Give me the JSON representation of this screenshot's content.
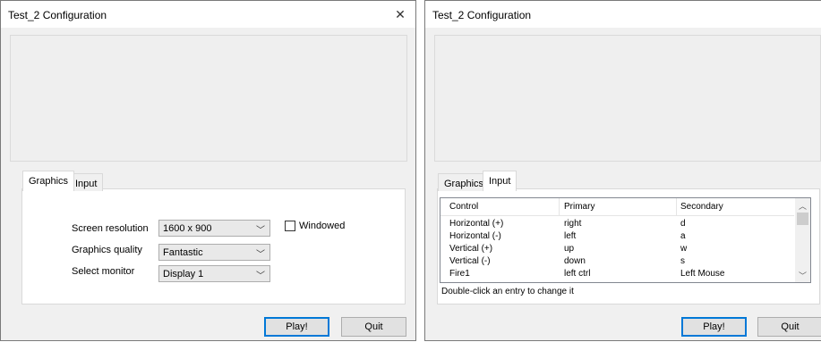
{
  "window_left": {
    "title": "Test_2 Configuration",
    "close_glyph": "✕",
    "tabs": [
      {
        "label": "Graphics"
      },
      {
        "label": "Input"
      }
    ],
    "active_tab": "Graphics",
    "settings": {
      "resolution_label": "Screen resolution",
      "resolution_value": "1600 x 900",
      "quality_label": "Graphics quality",
      "quality_value": "Fantastic",
      "monitor_label": "Select monitor",
      "monitor_value": "Display 1",
      "windowed_label": "Windowed",
      "windowed_checked": false
    },
    "buttons": {
      "play": "Play!",
      "quit": "Quit"
    }
  },
  "window_right": {
    "title": "Test_2 Configuration",
    "close_glyph": "✕",
    "tabs": [
      {
        "label": "Graphics"
      },
      {
        "label": "Input"
      }
    ],
    "active_tab": "Input",
    "input_table": {
      "columns": [
        "Control",
        "Primary",
        "Secondary"
      ],
      "rows": [
        {
          "control": "Horizontal (+)",
          "primary": "right",
          "secondary": "d"
        },
        {
          "control": "Horizontal (-)",
          "primary": "left",
          "secondary": "a"
        },
        {
          "control": "Vertical (+)",
          "primary": "up",
          "secondary": "w"
        },
        {
          "control": "Vertical (-)",
          "primary": "down",
          "secondary": "s"
        },
        {
          "control": "Fire1",
          "primary": "left ctrl",
          "secondary": "Left Mouse"
        }
      ]
    },
    "hint": "Double-click an entry to change it",
    "buttons": {
      "play": "Play!",
      "quit": "Quit"
    }
  },
  "icons": {
    "chevron_down": "chevron-down-icon",
    "close": "close-icon",
    "scroll_up": "scroll-up-arrow-icon",
    "scroll_down": "scroll-down-arrow-icon"
  }
}
